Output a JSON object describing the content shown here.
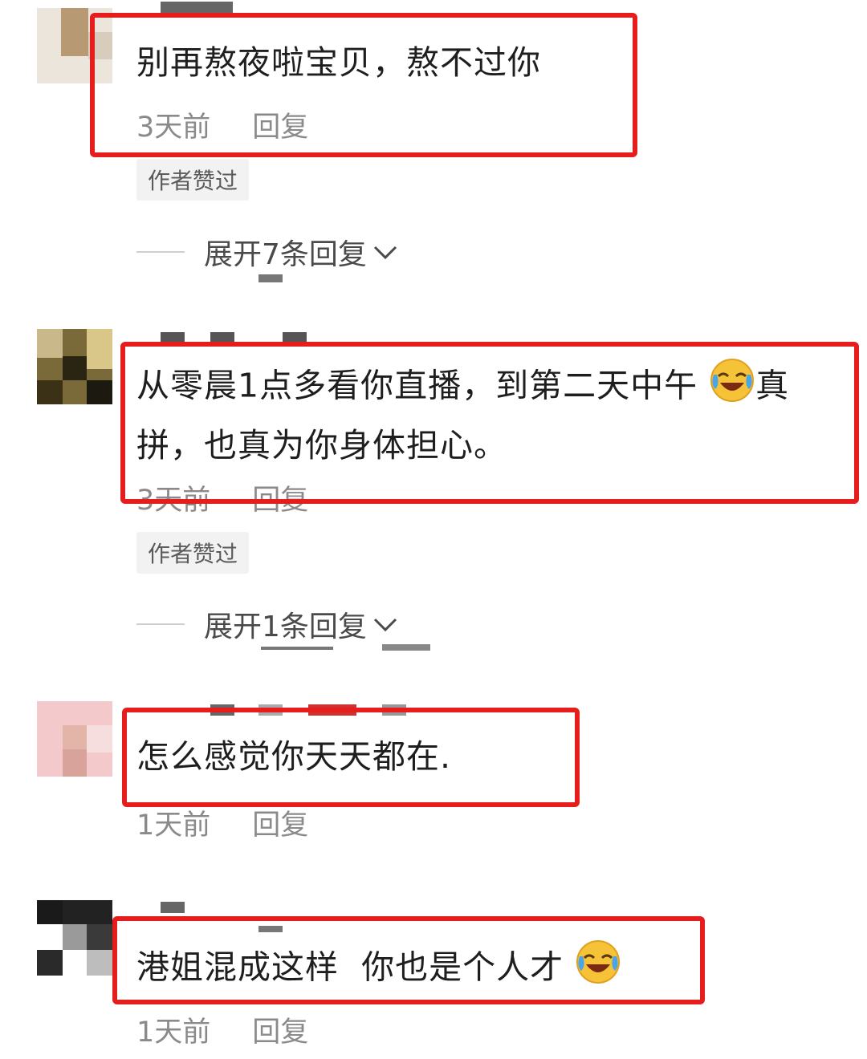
{
  "comments": [
    {
      "text": "别再熬夜啦宝贝，熬不过你",
      "time": "3天前",
      "reply": "回复",
      "liked_badge": "作者赞过",
      "expand_label": "展开7条回复"
    },
    {
      "text_line1": "从零晨1点多看你直播，到第二天中午",
      "text_line1_end": "真",
      "text_line2": "拼，也真为你身体担心。",
      "time": "3天前",
      "reply": "回复",
      "liked_badge": "作者赞过",
      "expand_label": "展开1条回复"
    },
    {
      "text": "怎么感觉你天天都在.",
      "time": "1天前",
      "reply": "回复"
    },
    {
      "text": "港姐混成这样  你也是个人才",
      "time": "1天前",
      "reply": "回复"
    }
  ],
  "icons": {
    "emoji": "laughing-crying-emoji-icon",
    "chevron": "chevron-down-icon"
  },
  "colors": {
    "highlight_border": "#e51d1d",
    "meta_text": "#8a8a8a"
  }
}
